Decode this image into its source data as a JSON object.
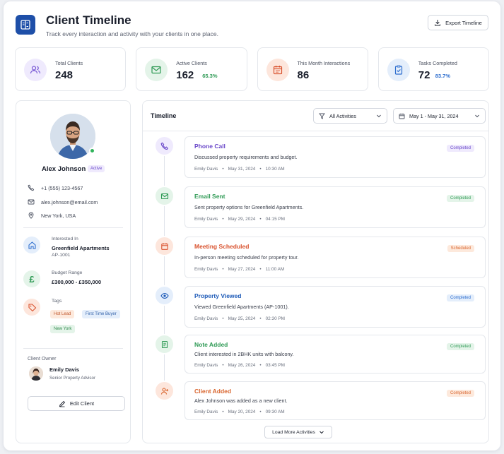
{
  "header": {
    "title": "Client Timeline",
    "subtitle": "Track every interaction and activity with your clients in one place.",
    "export_label": "Export Timeline"
  },
  "stats": [
    {
      "label": "Total Clients",
      "value": "248",
      "pct": "",
      "icon": "users-icon",
      "color": "#7b5bd6",
      "bg": "#efeafd"
    },
    {
      "label": "Active Clients",
      "value": "162",
      "pct": "65.3%",
      "icon": "mail-icon",
      "color": "#2f9a55",
      "bg": "#e4f4e9"
    },
    {
      "label": "This Month Interactions",
      "value": "86",
      "pct": "",
      "icon": "calendar-icon",
      "color": "#d9532f",
      "bg": "#fde6dc"
    },
    {
      "label": "Tasks Completed",
      "value": "72",
      "pct": "83.7%",
      "icon": "clipboard-check-icon",
      "color": "#2f6fcf",
      "bg": "#e4eefb"
    }
  ],
  "client": {
    "name": "Alex Johnson",
    "status": "Active",
    "phone": "+1 (555) 123-4567",
    "email": "alex.johnson@email.com",
    "location": "New York, USA",
    "interested_label": "Interested In",
    "interested_value": "Greenfield Apartments",
    "interested_code": "AP-1001",
    "budget_label": "Budget Range",
    "budget_value": "£300,000 - £350,000",
    "tags_label": "Tags",
    "tags": [
      "Hot Lead",
      "First Time Buyer",
      "New York"
    ],
    "owner_title": "Client Owner",
    "owner_name": "Emily Davis",
    "owner_role": "Senior Property Advisor",
    "edit_label": "Edit Client"
  },
  "timeline": {
    "title": "Timeline",
    "filter_label": "All Activities",
    "date_range": "May 1 - May 31, 2024",
    "load_more": "Load More Activities",
    "events": [
      {
        "title": "Phone Call",
        "desc": "Discussed property requirements and budget.",
        "agent": "Emily Davis",
        "date": "May 31, 2024",
        "time": "10:30 AM",
        "status": "Completed",
        "color": "#6a48c9",
        "bg": "#efeafd",
        "status_color": "#6a48c9",
        "status_bg": "#efeafd",
        "icon": "phone-icon"
      },
      {
        "title": "Email Sent",
        "desc": "Sent property options for Greenfield Apartments.",
        "agent": "Emily Davis",
        "date": "May 29, 2024",
        "time": "04:15 PM",
        "status": "Completed",
        "color": "#2f9a55",
        "bg": "#e4f4e9",
        "status_color": "#2f9a55",
        "status_bg": "#e4f4e9",
        "icon": "mail-icon"
      },
      {
        "title": "Meeting Scheduled",
        "desc": "In-person meeting scheduled for property tour.",
        "agent": "Emily Davis",
        "date": "May 27, 2024",
        "time": "11:00 AM",
        "status": "Scheduled",
        "color": "#d9532f",
        "bg": "#fde6dc",
        "status_color": "#d9662f",
        "status_bg": "#fde9dc",
        "icon": "calendar-icon"
      },
      {
        "title": "Property Viewed",
        "desc": "Viewed Greenfield Apartments (AP-1001).",
        "agent": "Emily Davis",
        "date": "May 25, 2024",
        "time": "02:30 PM",
        "status": "Completed",
        "color": "#1e5bb8",
        "bg": "#e4eefb",
        "status_color": "#2f6fcf",
        "status_bg": "#e4eefb",
        "icon": "eye-icon"
      },
      {
        "title": "Note Added",
        "desc": "Client interested in 2BHK units with balcony.",
        "agent": "Emily Davis",
        "date": "May 26, 2024",
        "time": "03:45 PM",
        "status": "Completed",
        "color": "#2f9a55",
        "bg": "#e4f4e9",
        "status_color": "#2f9a55",
        "status_bg": "#e4f4e9",
        "icon": "note-icon"
      },
      {
        "title": "Client Added",
        "desc": "Alex Johnson was added as a new client.",
        "agent": "Emily Davis",
        "date": "May 20, 2024",
        "time": "09:30 AM",
        "status": "Completed",
        "color": "#d9662f",
        "bg": "#fde6dc",
        "status_color": "#d9662f",
        "status_bg": "#fde9dc",
        "icon": "user-plus-icon"
      }
    ]
  }
}
